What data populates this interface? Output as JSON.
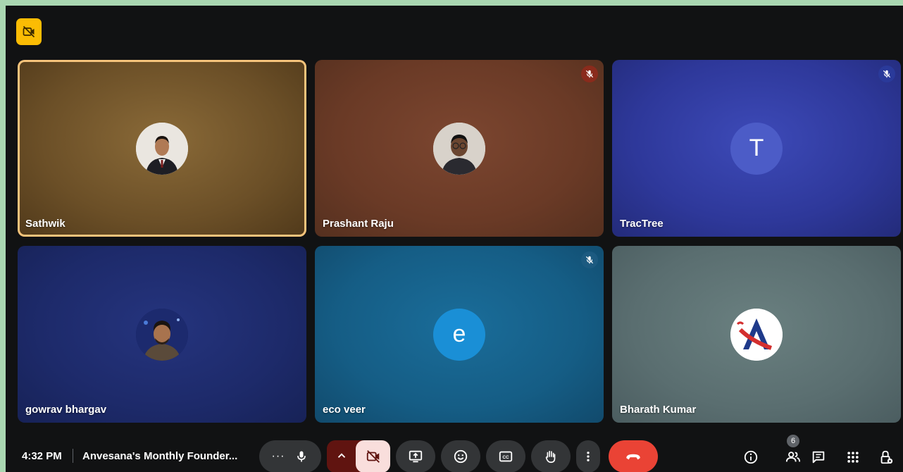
{
  "participants": [
    {
      "name": "Sathwik",
      "avatar": "photo",
      "muted": false,
      "active_speaker": true
    },
    {
      "name": "Prashant Raju",
      "avatar": "photo",
      "muted": true,
      "active_speaker": false
    },
    {
      "name": "TracTree",
      "avatar_letter": "T",
      "muted": true,
      "active_speaker": false
    },
    {
      "name": "gowrav bhargav",
      "avatar": "photo",
      "muted": false,
      "active_speaker": false
    },
    {
      "name": "eco veer",
      "avatar_letter": "e",
      "muted": true,
      "active_speaker": false
    },
    {
      "name": "Bharath Kumar",
      "avatar": "logo",
      "muted": false,
      "active_speaker": false
    }
  ],
  "bottom_bar": {
    "time": "4:32 PM",
    "meeting_title": "Anvesana's Monthly Founder...",
    "people_count": "6"
  },
  "icons": {
    "top_badge": "camera-off-icon",
    "controls": [
      "more-options-icon",
      "microphone-icon",
      "chevron-up-icon",
      "camera-off-icon",
      "present-screen-icon",
      "emoji-icon",
      "captions-icon",
      "raise-hand-icon",
      "more-vertical-icon",
      "hang-up-icon"
    ],
    "right": [
      "info-icon",
      "people-icon",
      "chat-icon",
      "activities-icon",
      "host-controls-icon"
    ]
  },
  "colors": {
    "active_speaker_border": "#f5c37b",
    "hangup": "#ea4335",
    "camera_off_bg": "#f9dedc",
    "badge": "#fbbc04"
  }
}
